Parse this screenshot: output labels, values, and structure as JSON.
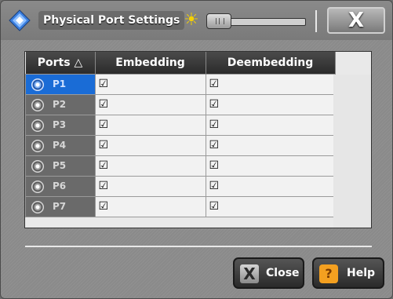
{
  "window": {
    "title": "Physical Port Settings"
  },
  "icons": {
    "logo": "app-logo-icon",
    "brightness": "sun-icon",
    "close": "close-x-icon",
    "help": "help-icon"
  },
  "table": {
    "headers": [
      "Ports △",
      "Embedding",
      "Deembedding"
    ],
    "rows": [
      {
        "port": "P1",
        "embedding": true,
        "deembedding": true,
        "selected": true
      },
      {
        "port": "P2",
        "embedding": true,
        "deembedding": true
      },
      {
        "port": "P3",
        "embedding": true,
        "deembedding": true
      },
      {
        "port": "P4",
        "embedding": true,
        "deembedding": true
      },
      {
        "port": "P5",
        "embedding": true,
        "deembedding": true
      },
      {
        "port": "P6",
        "embedding": true,
        "deembedding": true
      },
      {
        "port": "P7",
        "embedding": true,
        "deembedding": true
      }
    ]
  },
  "buttons": {
    "close": "Close",
    "help": "Help"
  },
  "checkbox_glyph": "☑"
}
